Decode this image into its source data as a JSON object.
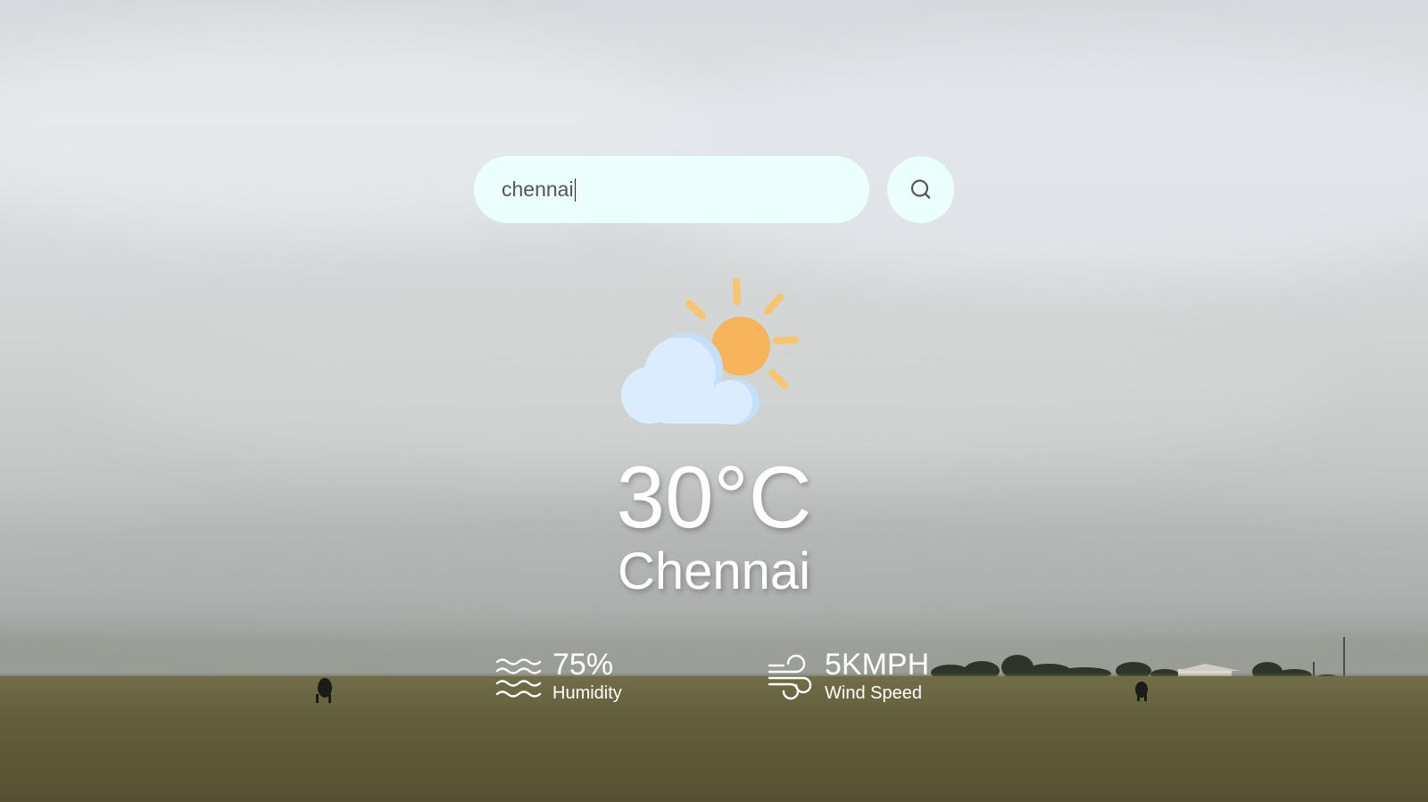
{
  "search": {
    "value": "chennai",
    "button_icon": "search-icon"
  },
  "weather": {
    "icon": "partly-cloudy-icon",
    "temperature": "30°C",
    "city": "Chennai"
  },
  "details": {
    "humidity": {
      "icon": "humidity-waves-icon",
      "value": "75%",
      "label": "Humidity"
    },
    "wind": {
      "icon": "wind-icon",
      "value": "5KMPH",
      "label": "Wind Speed"
    }
  },
  "colors": {
    "search_background": "#ebfffc",
    "sun": "#f6b55b",
    "sun_rays": "#f7c56a",
    "cloud": "#dcecff",
    "text": "#ffffff"
  }
}
